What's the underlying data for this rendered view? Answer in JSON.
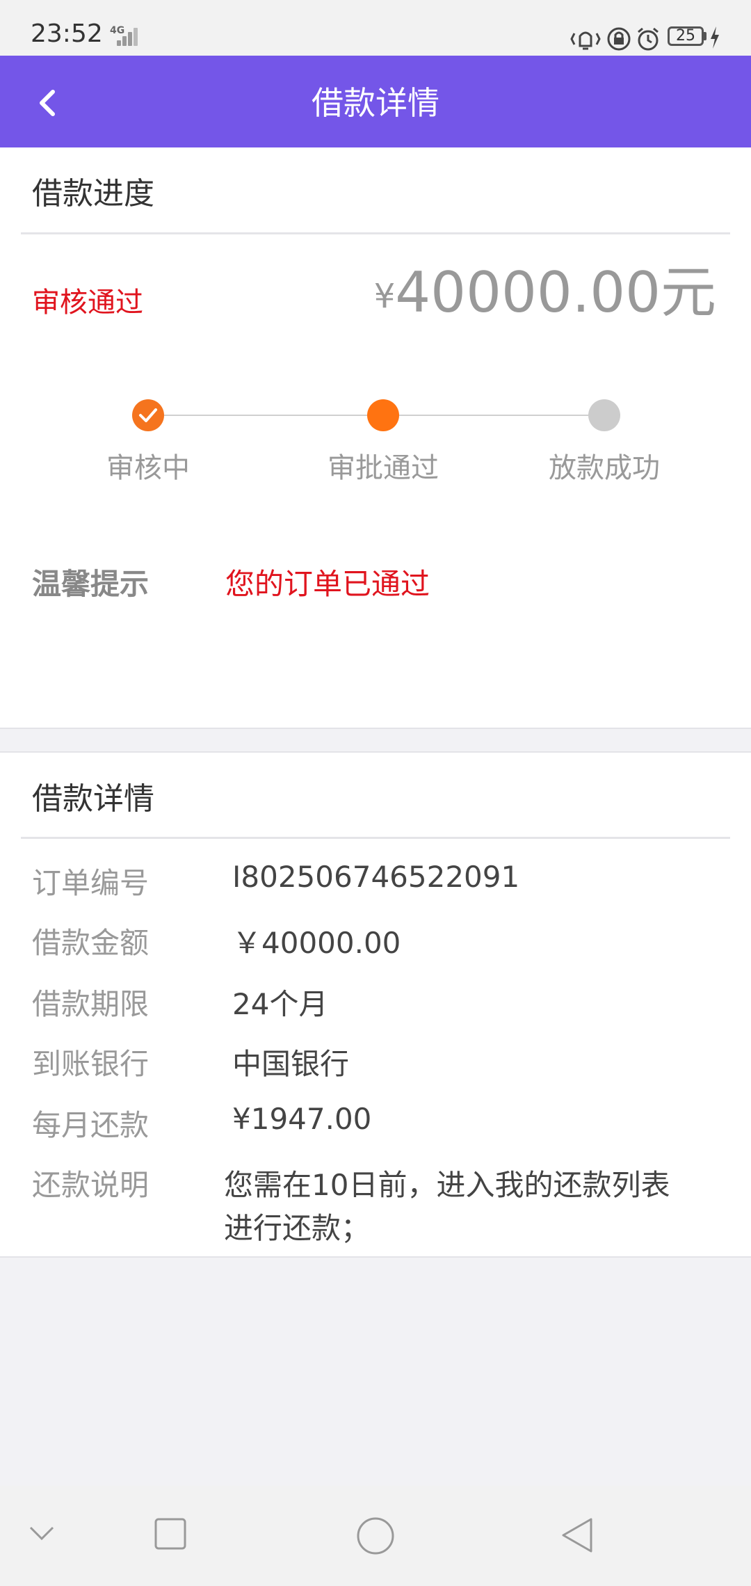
{
  "status_bar": {
    "time": "23:52",
    "network": "4G",
    "battery": "25",
    "icons": [
      "vibrate-icon",
      "lock-rotation-icon",
      "alarm-icon",
      "battery-icon",
      "charging-icon"
    ]
  },
  "header": {
    "title": "借款详情",
    "back_icon": "back-arrow-icon"
  },
  "progress": {
    "section_title": "借款进度",
    "status": "审核通过",
    "amount_currency": "¥",
    "amount_value": "40000.00元",
    "steps": [
      {
        "label": "审核中",
        "state": "done"
      },
      {
        "label": "审批通过",
        "state": "current"
      },
      {
        "label": "放款成功",
        "state": "pending"
      }
    ],
    "colors": {
      "done": "#f5741e",
      "current": "#ff7311",
      "pending": "#cccccc",
      "status": "#e0141e"
    },
    "tip_label": "温馨提示",
    "tip_text": "您的订单已通过"
  },
  "details": {
    "section_title": "借款详情",
    "rows": [
      {
        "label": "订单编号",
        "value": "I802506746522091"
      },
      {
        "label": "借款金额",
        "value": "￥40000.00"
      },
      {
        "label": "借款期限",
        "value": "24个月"
      },
      {
        "label": "到账银行",
        "value": "中国银行"
      },
      {
        "label": "每月还款",
        "value": "¥1947.00"
      },
      {
        "label": "还款说明",
        "value_line1": "您需在10日前，进入我的还款列表",
        "value_line2": "进行还款；"
      }
    ]
  },
  "theme": {
    "header_bg": "#7456e8",
    "page_bg": "#f2f2f5"
  },
  "nav_bar": {
    "icons": [
      "collapse-icon",
      "recent-apps-icon",
      "home-icon",
      "back-icon"
    ]
  }
}
